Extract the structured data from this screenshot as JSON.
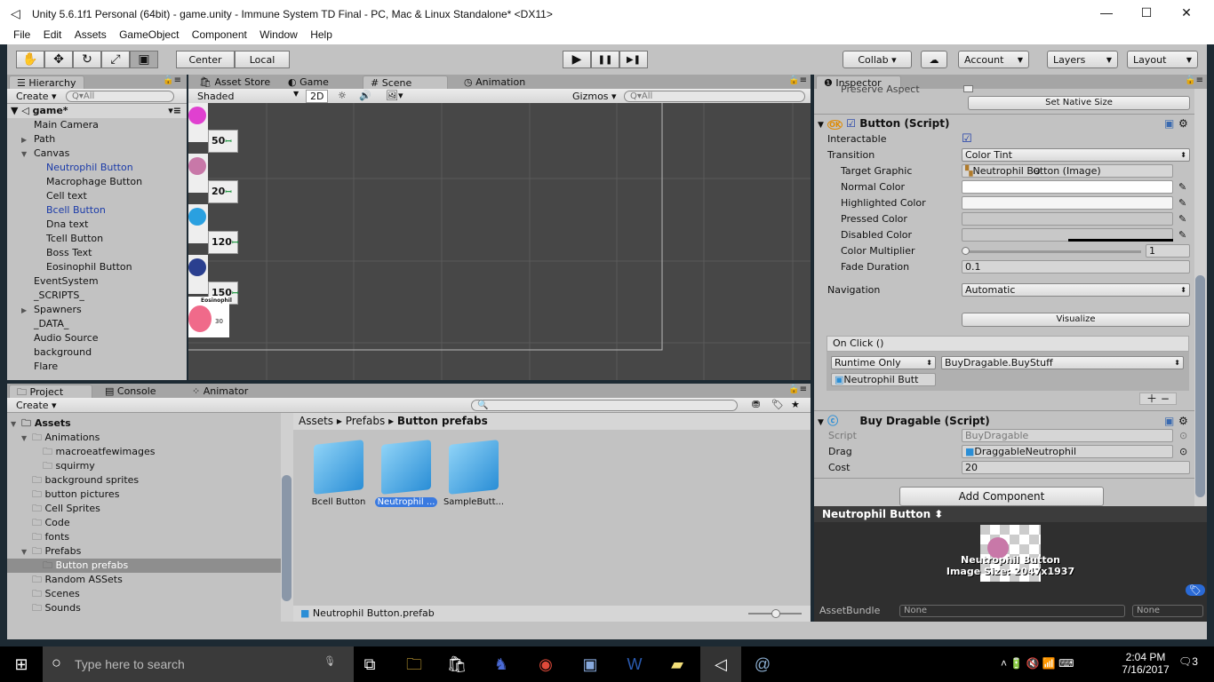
{
  "window": {
    "title": "Unity 5.6.1f1 Personal (64bit) - game.unity - Immune System TD Final - PC, Mac & Linux Standalone* <DX11>",
    "minimize": "—",
    "maximize": "☐",
    "close": "✕"
  },
  "menu": [
    "File",
    "Edit",
    "Assets",
    "GameObject",
    "Component",
    "Window",
    "Help"
  ],
  "toolbar": {
    "tools": [
      "✋",
      "✥",
      "↻",
      "⤢",
      "▣"
    ],
    "pivot": "Center",
    "space": "Local",
    "play": "▶",
    "pause": "❚❚",
    "step": "▶❚",
    "collab": "Collab ▾",
    "cloud": "☁",
    "account": "Account",
    "layers": "Layers",
    "layout": "Layout"
  },
  "hierarchy": {
    "tab": "Hierarchy",
    "create": "Create ▾",
    "search_placeholder": "Q▾All",
    "scene": "game*",
    "items": [
      {
        "label": "Main Camera",
        "depth": 1,
        "arrow": "",
        "color": "normal"
      },
      {
        "label": "Path",
        "depth": 1,
        "arrow": "▶",
        "color": "normal"
      },
      {
        "label": "Canvas",
        "depth": 1,
        "arrow": "▼",
        "color": "normal"
      },
      {
        "label": "Neutrophil Button",
        "depth": 2,
        "arrow": "",
        "color": "blue"
      },
      {
        "label": "Macrophage Button",
        "depth": 2,
        "arrow": "",
        "color": "normal"
      },
      {
        "label": "Cell text",
        "depth": 2,
        "arrow": "",
        "color": "normal"
      },
      {
        "label": "Bcell Button",
        "depth": 2,
        "arrow": "",
        "color": "blue"
      },
      {
        "label": "Dna text",
        "depth": 2,
        "arrow": "",
        "color": "normal"
      },
      {
        "label": "Tcell Button",
        "depth": 2,
        "arrow": "",
        "color": "normal"
      },
      {
        "label": "Boss Text",
        "depth": 2,
        "arrow": "",
        "color": "normal"
      },
      {
        "label": "Eosinophil Button",
        "depth": 2,
        "arrow": "",
        "color": "normal"
      },
      {
        "label": "EventSystem",
        "depth": 1,
        "arrow": "",
        "color": "normal"
      },
      {
        "label": "_SCRIPTS_",
        "depth": 1,
        "arrow": "",
        "color": "normal"
      },
      {
        "label": "Spawners",
        "depth": 1,
        "arrow": "▶",
        "color": "normal"
      },
      {
        "label": "_DATA_",
        "depth": 1,
        "arrow": "",
        "color": "normal"
      },
      {
        "label": "Audio Source",
        "depth": 1,
        "arrow": "",
        "color": "normal"
      },
      {
        "label": "background",
        "depth": 1,
        "arrow": "",
        "color": "normal"
      },
      {
        "label": "Flare",
        "depth": 1,
        "arrow": "",
        "color": "normal"
      }
    ]
  },
  "scene_panel": {
    "tabs": [
      "Asset Store",
      "Game",
      "Scene",
      "Animation"
    ],
    "active_tab": "Scene",
    "shading": "Shaded",
    "mode_2d": "2D",
    "gizmos": "Gizmos ▾",
    "search_placeholder": "Q▾All",
    "buttons": [
      {
        "cost": "50",
        "color": "#e040d0"
      },
      {
        "cost": "20",
        "color": "#c878a8"
      },
      {
        "cost": "120",
        "color": "#2aa0e0"
      },
      {
        "cost": "150",
        "color": "#2a3f8f"
      }
    ],
    "eosinophil": {
      "title": "Eosinophil",
      "cost": "30"
    }
  },
  "project": {
    "tabs": [
      "Project",
      "Console",
      "Animator"
    ],
    "create": "Create ▾",
    "tree": [
      {
        "label": "Assets",
        "depth": 0,
        "arrow": "▼",
        "bold": true
      },
      {
        "label": "Animations",
        "depth": 1,
        "arrow": "▼"
      },
      {
        "label": "macroeatfewimages",
        "depth": 2,
        "arrow": ""
      },
      {
        "label": "squirmy",
        "depth": 2,
        "arrow": ""
      },
      {
        "label": "background sprites",
        "depth": 1,
        "arrow": ""
      },
      {
        "label": "button pictures",
        "depth": 1,
        "arrow": ""
      },
      {
        "label": "Cell Sprites",
        "depth": 1,
        "arrow": ""
      },
      {
        "label": "Code",
        "depth": 1,
        "arrow": ""
      },
      {
        "label": "fonts",
        "depth": 1,
        "arrow": ""
      },
      {
        "label": "Prefabs",
        "depth": 1,
        "arrow": "▼"
      },
      {
        "label": "Button prefabs",
        "depth": 2,
        "arrow": "",
        "selected": true
      },
      {
        "label": "Random ASSets",
        "depth": 1,
        "arrow": ""
      },
      {
        "label": "Scenes",
        "depth": 1,
        "arrow": ""
      },
      {
        "label": "Sounds",
        "depth": 1,
        "arrow": ""
      }
    ],
    "breadcrumb": [
      "Assets",
      "Prefabs",
      "Button prefabs"
    ],
    "assets": [
      {
        "label": "Bcell Button",
        "selected": false
      },
      {
        "label": "Neutrophil ...",
        "selected": true
      },
      {
        "label": "SampleButt...",
        "selected": false
      }
    ],
    "footer_file": "Neutrophil Button.prefab"
  },
  "inspector": {
    "tab": "Inspector",
    "preserve_aspect": "Preserve Aspect",
    "set_native_size": "Set Native Size",
    "button_component": {
      "title": "Button (Script)",
      "enabled": true,
      "interactable_label": "Interactable",
      "interactable": true,
      "transition_label": "Transition",
      "transition": "Color Tint",
      "target_graphic_label": "Target Graphic",
      "target_graphic": "Neutrophil Button (Image)",
      "normal_color_label": "Normal Color",
      "normal_color": "#ffffff",
      "highlighted_color_label": "Highlighted Color",
      "highlighted_color": "#f5f5f5",
      "pressed_color_label": "Pressed Color",
      "pressed_color": "#c8c8c8",
      "disabled_color_label": "Disabled Color",
      "disabled_color": "#c8c8c8",
      "color_multiplier_label": "Color Multiplier",
      "color_multiplier": "1",
      "fade_duration_label": "Fade Duration",
      "fade_duration": "0.1",
      "navigation_label": "Navigation",
      "navigation": "Automatic",
      "visualize": "Visualize",
      "on_click_label": "On Click ()",
      "runtime": "Runtime Only",
      "function": "BuyDragable.BuyStuff",
      "target_object": "Neutrophil Butt"
    },
    "buy_component": {
      "title": "Buy Dragable (Script)",
      "script_label": "Script",
      "script": "BuyDragable",
      "drag_label": "Drag",
      "drag": "DraggableNeutrophil",
      "cost_label": "Cost",
      "cost": "20"
    },
    "add_component": "Add Component",
    "preview": {
      "title": "Neutrophil Button",
      "caption1": "Neutrophil Button",
      "caption2": "Image Size: 2047x1937"
    },
    "assetbundle_label": "AssetBundle",
    "assetbundle": "None",
    "variant": "None"
  },
  "taskbar": {
    "search_placeholder": "Type here to search",
    "time": "2:04 PM",
    "date": "7/16/2017",
    "notifications": "3"
  }
}
